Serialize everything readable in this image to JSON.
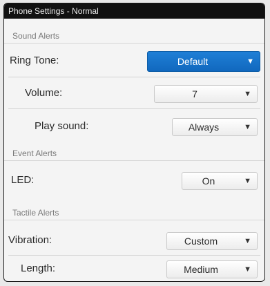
{
  "window": {
    "title": "Phone Settings - Normal"
  },
  "sections": {
    "sound_alerts": {
      "label": "Sound Alerts"
    },
    "event_alerts": {
      "label": "Event Alerts"
    },
    "tactile_alerts": {
      "label": "Tactile Alerts"
    }
  },
  "rows": {
    "ring_tone": {
      "label": "Ring Tone:",
      "value": "Default"
    },
    "volume": {
      "label": "Volume:",
      "value": "7"
    },
    "play_sound": {
      "label": "Play sound:",
      "value": "Always"
    },
    "led": {
      "label": "LED:",
      "value": "On"
    },
    "vibration": {
      "label": "Vibration:",
      "value": "Custom"
    },
    "length": {
      "label": "Length:",
      "value": "Medium"
    }
  },
  "icons": {
    "dropdown": "chevron-down-icon"
  },
  "colors": {
    "accent": "#1a74cc",
    "titlebar": "#111111"
  }
}
